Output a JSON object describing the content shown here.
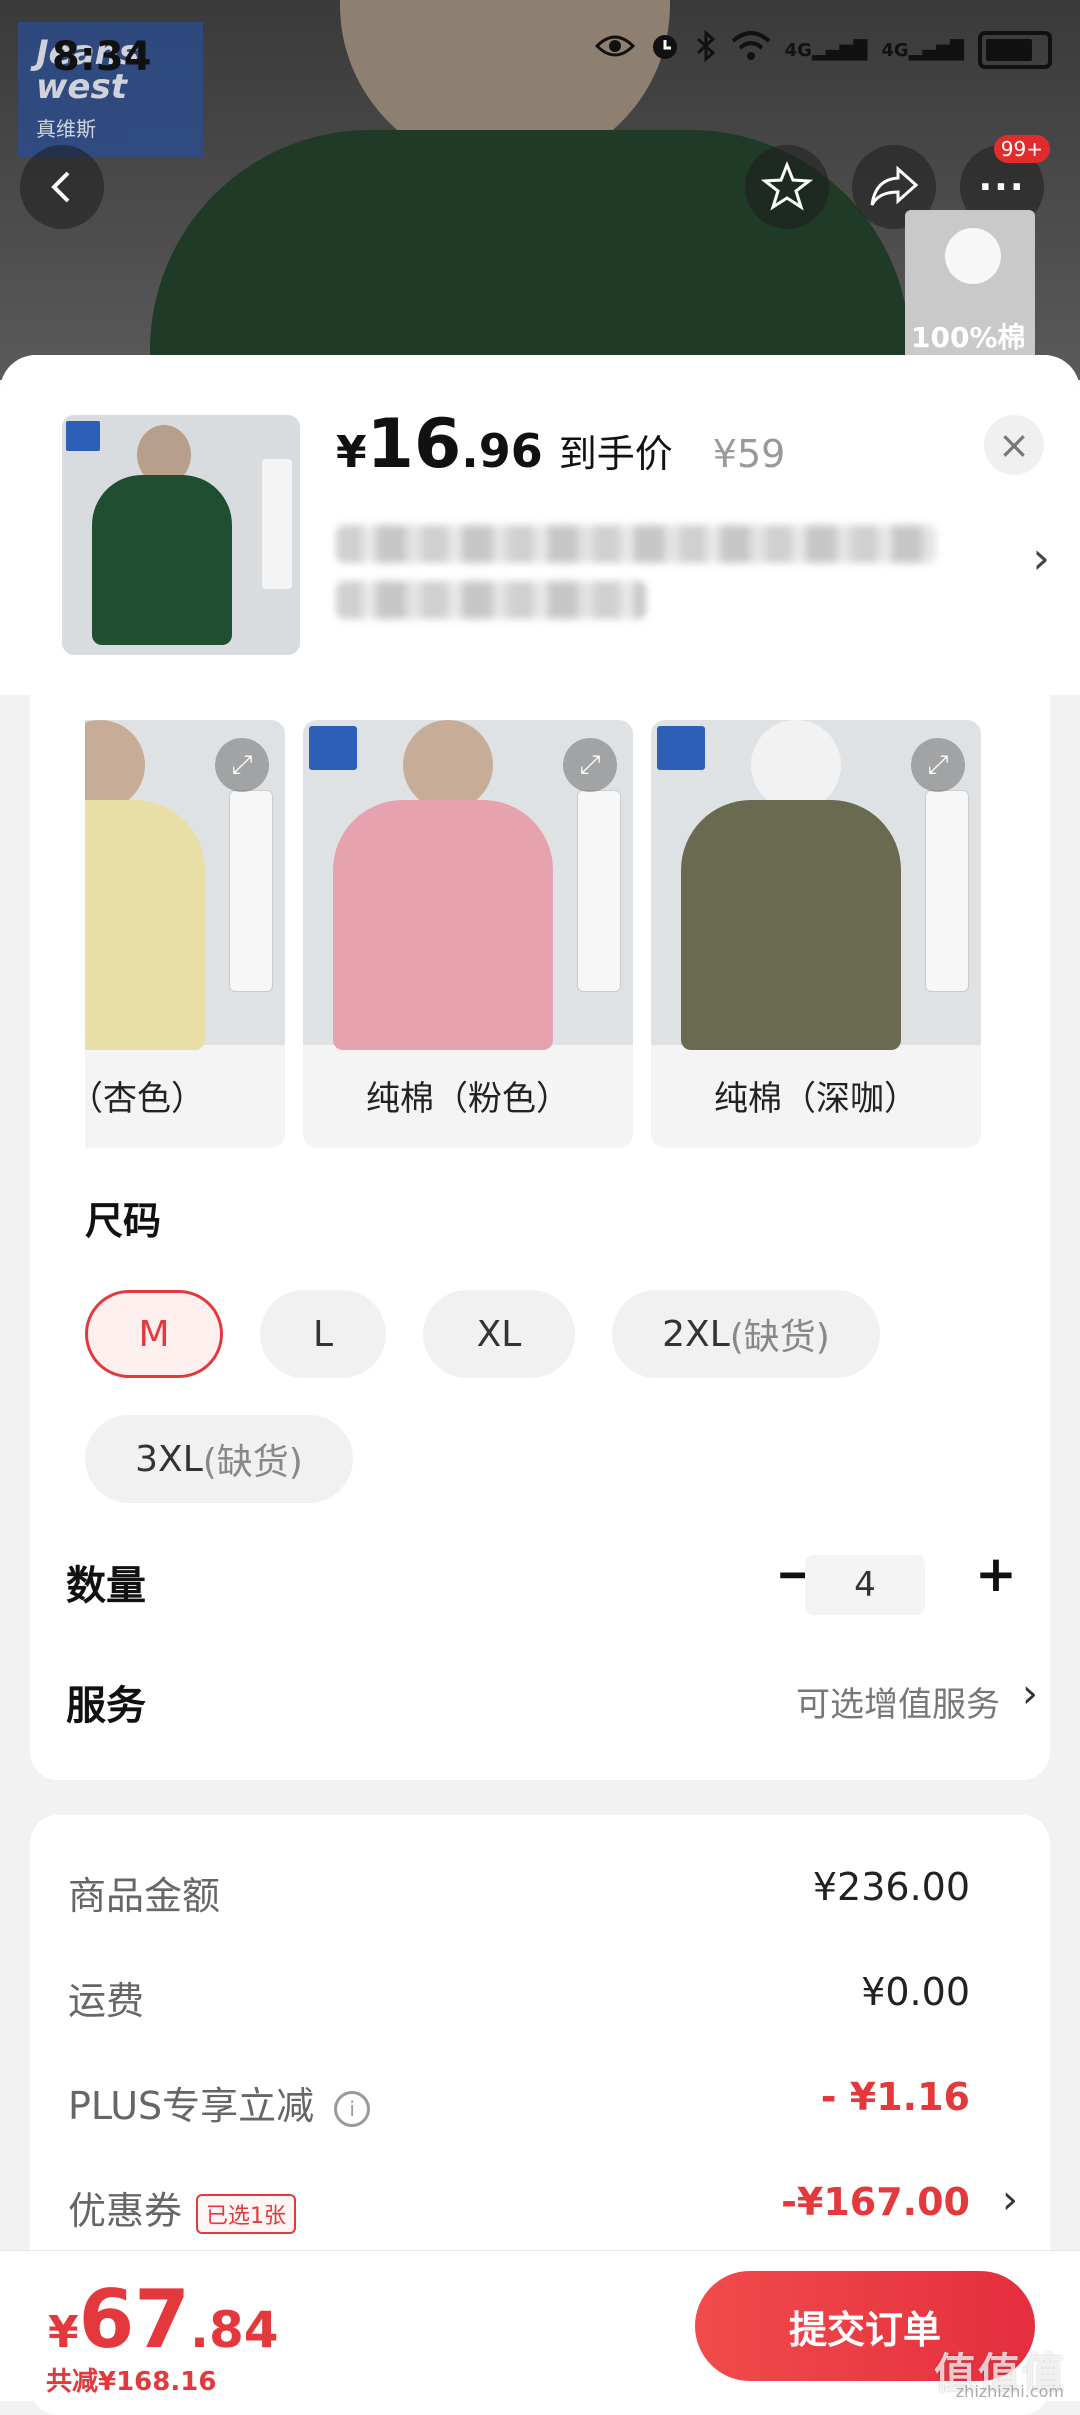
{
  "status_bar": {
    "time": "8:34",
    "signal_labels": [
      "4G",
      "4G"
    ]
  },
  "brand": {
    "name": "Jeans west",
    "sub": "真维斯"
  },
  "header": {
    "badge": "99+",
    "corner_label": "100%棉"
  },
  "product": {
    "currency": "¥",
    "price_int": "16",
    "price_dec": ".96",
    "price_tag": "到手价",
    "original_price": "¥59",
    "close": "×",
    "title_chevron": "›"
  },
  "variants": [
    {
      "label": "棉（杏色）",
      "color": "#e9dfa6"
    },
    {
      "label": "纯棉（粉色）",
      "color": "#e7a2b0"
    },
    {
      "label": "纯棉（深咖）",
      "color": "#6a6a50"
    }
  ],
  "variant_strip_label": "100%棉",
  "sizes": {
    "title": "尺码",
    "options": [
      {
        "size": "M",
        "note": "",
        "selected": true
      },
      {
        "size": "L",
        "note": "",
        "selected": false
      },
      {
        "size": "XL",
        "note": "",
        "selected": false
      },
      {
        "size": "2XL",
        "note": "(缺货)",
        "selected": false
      },
      {
        "size": "3XL",
        "note": "(缺货)",
        "selected": false
      }
    ]
  },
  "quantity": {
    "label": "数量",
    "value": "4",
    "minus": "−",
    "plus": "+"
  },
  "service": {
    "label": "服务",
    "hint": "可选增值服务",
    "chevron": "›"
  },
  "summary": {
    "goods_label": "商品金额",
    "goods_value": "¥236.00",
    "shipping_label": "运费",
    "shipping_value": "¥0.00",
    "plus_label": "PLUS专享立减",
    "plus_info": "i",
    "plus_value": "- ¥1.16",
    "coupon_label": "优惠券",
    "coupon_tag": "已选1张",
    "coupon_value": "-¥167.00",
    "coupon_chevron": "›"
  },
  "footer": {
    "currency": "¥",
    "total_int": "67",
    "total_dec": ".84",
    "discount": "共减¥168.16",
    "submit": "提交订单"
  },
  "watermark": {
    "text": "值值值",
    "site": "zhizhizhi.com"
  },
  "colors": {
    "accent": "#e4393c",
    "chip_bg": "#f1f1f1",
    "panel_bg": "#ffffff",
    "page_bg": "#f2f2f2"
  }
}
